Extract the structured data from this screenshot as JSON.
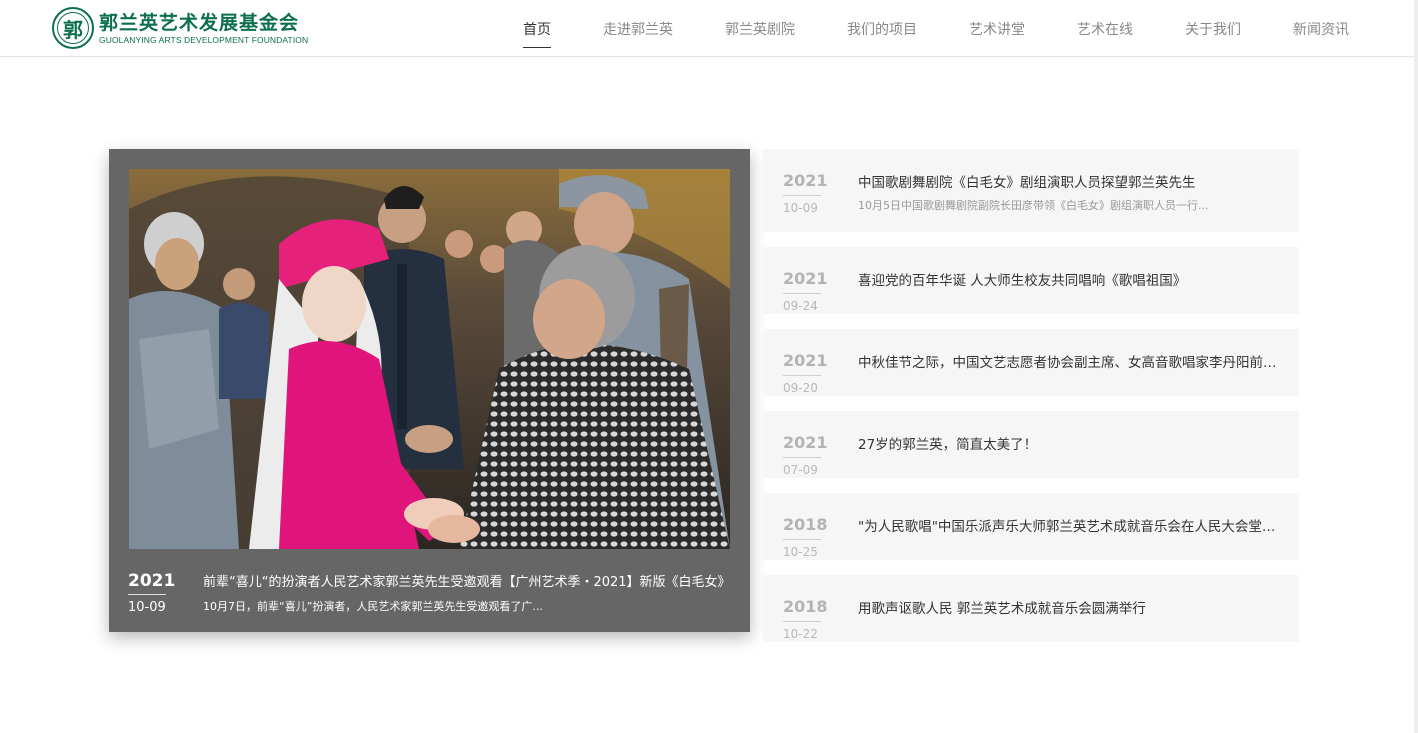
{
  "brand": {
    "seal_char": "郭",
    "name_cn": "郭兰英艺术发展基金会",
    "name_en": "GUOLANYING ARTS DEVELOPMENT FOUNDATION",
    "color": "#0e6e50"
  },
  "nav": [
    {
      "label": "首页",
      "active": true
    },
    {
      "label": "走进郭兰英"
    },
    {
      "label": "郭兰英剧院"
    },
    {
      "label": "我们的项目"
    },
    {
      "label": "艺术讲堂"
    },
    {
      "label": "艺术在线"
    },
    {
      "label": "关于我们"
    },
    {
      "label": "新闻资讯"
    }
  ],
  "featured": {
    "year": "2021",
    "date": "10-09",
    "title": "前辈“喜儿“的扮演者人民艺术家郭兰英先生受邀观看【广州艺术季・2021】新版《白毛女》",
    "description": "10月7日，前辈“喜儿”扮演者，人民艺术家郭兰英先生受邀观看了广...",
    "image_alt": "photo-performers-greeting"
  },
  "news": [
    {
      "year": "2021",
      "date": "10-09",
      "title": "中国歌剧舞剧院《白毛女》剧组演职人员探望郭兰英先生",
      "description": "10月5日中国歌剧舞剧院副院长田彦带领《白毛女》剧组演职人员一行..."
    },
    {
      "year": "2021",
      "date": "09-24",
      "title": "喜迎党的百年华诞 人大师生校友共同唱响《歌唱祖国》",
      "description": ""
    },
    {
      "year": "2021",
      "date": "09-20",
      "title": "中秋佳节之际，中国文艺志愿者协会副主席、女高音歌唱家李丹阳前往探望郭兰英先生",
      "description": ""
    },
    {
      "year": "2021",
      "date": "07-09",
      "title": "27岁的郭兰英，简直太美了！",
      "description": ""
    },
    {
      "year": "2018",
      "date": "10-25",
      "title": "\"为人民歌唱\"中国乐派声乐大师郭兰英艺术成就音乐会在人民大会堂隆重举行",
      "description": ""
    },
    {
      "year": "2018",
      "date": "10-22",
      "title": "用歌声讴歌人民 郭兰英艺术成就音乐会圆满举行",
      "description": ""
    }
  ]
}
